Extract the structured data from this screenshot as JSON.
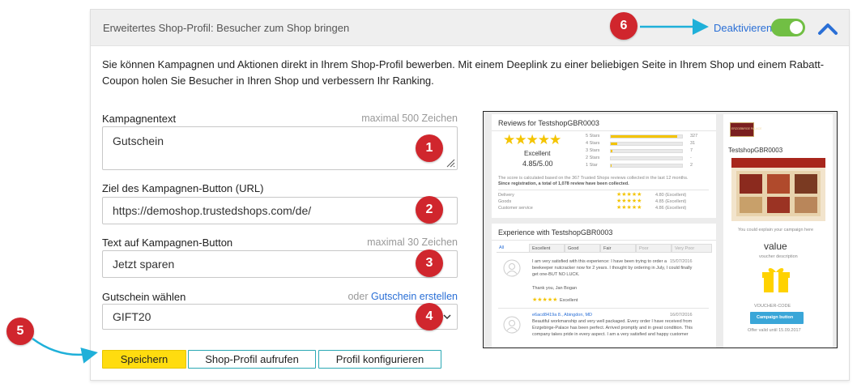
{
  "header": {
    "title": "Erweitertes Shop-Profil: Besucher zum Shop bringen",
    "deactivate_label": "Deaktivieren",
    "toggle_state": "on"
  },
  "intro_text": "Sie können Kampagnen und Aktionen direkt in Ihrem Shop-Profil bewerben. Mit einem Deeplink zu einer beliebigen Seite in Ihrem Shop und einem Rabatt-Coupon holen Sie Besucher in Ihren Shop und verbessern Ihr Ranking.",
  "form": {
    "campaign_text": {
      "label": "Kampagnentext",
      "hint": "maximal 500 Zeichen",
      "value": "Gutschein"
    },
    "target_url": {
      "label": "Ziel des Kampagnen-Button (URL)",
      "value": "https://demoshop.trustedshops.com/de/"
    },
    "button_text": {
      "label": "Text auf Kampagnen-Button",
      "hint": "maximal 30 Zeichen",
      "value": "Jetzt sparen"
    },
    "voucher": {
      "label": "Gutschein wählen",
      "hint_prefix": "oder",
      "hint_link": "Gutschein erstellen",
      "selected": "GIFT20"
    }
  },
  "buttons": {
    "save": "Speichern",
    "open_profile": "Shop-Profil aufrufen",
    "configure_profile": "Profil konfigurieren"
  },
  "badges": [
    "1",
    "2",
    "3",
    "4",
    "5",
    "6"
  ],
  "preview": {
    "reviews_title": "Reviews for TestshopGBR0003",
    "rating_word": "Excellent",
    "rating_score": "4.85/5.00",
    "distribution": [
      {
        "label": "5 Stars",
        "count": "327",
        "fraction": 0.93
      },
      {
        "label": "4 Stars",
        "count": "31",
        "fraction": 0.09
      },
      {
        "label": "3 Stars",
        "count": "7",
        "fraction": 0.02
      },
      {
        "label": "2 Stars",
        "count": "-",
        "fraction": 0
      },
      {
        "label": "1 Star",
        "count": "2",
        "fraction": 0.01
      }
    ],
    "score_note_1": "The score is calculated based on the 367 Trusted Shops reviews collected in the last 12 months.",
    "score_note_2": "Since registration, a total of 1,078 review have been collected.",
    "criteria": [
      {
        "label": "Delivery",
        "value": "4.80 (Excellent)"
      },
      {
        "label": "Goods",
        "value": "4.85 (Excellent)"
      },
      {
        "label": "Customer service",
        "value": "4.86 (Excellent)"
      }
    ],
    "experience_title": "Experience with TestshopGBR0003",
    "filter_tabs": [
      "All",
      "Excellent",
      "Good",
      "Fair",
      "Poor",
      "Very Poor"
    ],
    "review_1": {
      "date": "15/07/2016",
      "text_1": "I am very satisfied with this experience: I have been trying to order a",
      "text_2": "beekeeper nutcracker now for 2 years. I thought by ordering in July, I could finally",
      "text_3": "get one-BUT NO LUCK.",
      "signoff": "Thank you, Jan Bogan",
      "rating_word": "Excellent"
    },
    "review_2": {
      "author": "e6acd8419a 8., Abingdon, MD",
      "date": "16/07/2016",
      "text_1": "Beautiful workmanship and very well packaged. Every order I have received from",
      "text_2": "Erzgebirge-Palace has been perfect. Arrived promptly and in great condition. This",
      "text_3": "company takes pride in every aspect. I am a very satisfied and happy customer"
    },
    "shop_logo_text": "ERZGEBIRGE PALACE",
    "shop_name": "TestshopGBR0003",
    "campaign_explain": "You could explain your campaign here",
    "voucher_value": "value",
    "voucher_description": "voucher description",
    "voucher_code_label": "VOUCHER-CODE",
    "campaign_button": "Campaign button",
    "offer_valid": "Offer valid until 15.09.2017"
  }
}
